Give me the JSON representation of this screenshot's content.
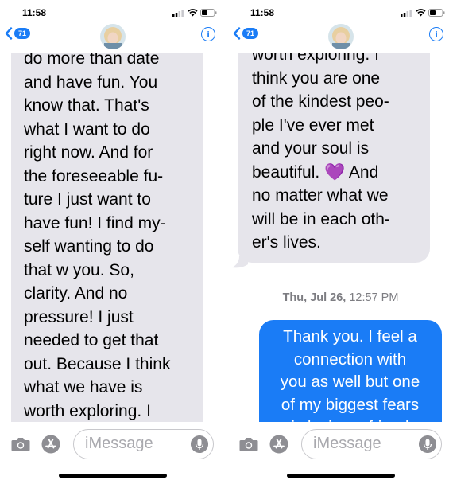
{
  "left": {
    "status": {
      "time": "11:58"
    },
    "nav": {
      "back_count": "71",
      "info_glyph": "i"
    },
    "incoming_text": "do more than date\nand have fun. You\nknow that. That's\nwhat I want to do\nright now. And for\nthe foreseeable fu-\nture I just want to\nhave fun! I find my-\nself wanting to do\nthat w you. So,\nclarity. And no\npressure! I just\nneeded to get that\nout. Because I think\nwhat we have is\nworth exploring. I",
    "composer": {
      "placeholder": "iMessage"
    }
  },
  "right": {
    "status": {
      "time": "11:58"
    },
    "nav": {
      "back_count": "71",
      "info_glyph": "i"
    },
    "incoming_text": "worth exploring. I\nthink you are one\nof the kindest peo-\nple I've ever met\nand your soul is\nbeautiful. 💜 And\nno matter what we\nwill be in each oth-\ner's lives.",
    "timestamp": {
      "day": "Thu, Jul 26,",
      "time": " 12:57 PM"
    },
    "outgoing_text": "Thank you. I feel a\nconnection with\nyou as well but one\nof my biggest fears\nis losing a friend",
    "composer": {
      "placeholder": "iMessage"
    }
  },
  "colors": {
    "accent": "#1a7cf6",
    "incoming_bg": "#e6e5eb",
    "timestamp": "#7d7d82"
  },
  "icons": [
    "signal-icon",
    "wifi-icon",
    "battery-icon",
    "back-chevron-icon",
    "info-icon",
    "camera-icon",
    "app-store-icon",
    "microphone-icon"
  ]
}
